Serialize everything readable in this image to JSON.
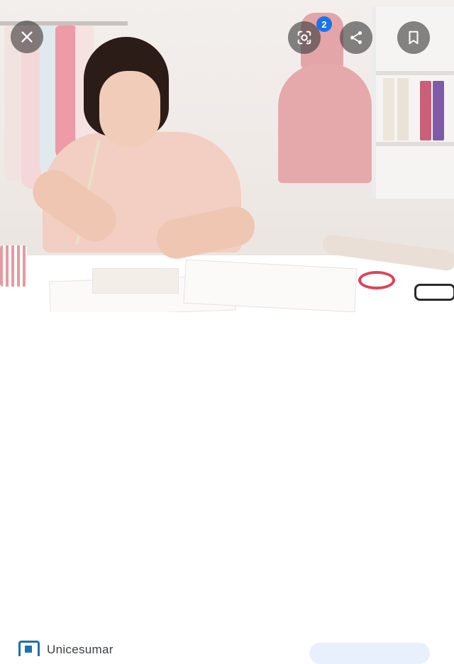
{
  "viewer": {
    "image_subject": "fashion-designer-sketching",
    "lens_badge_count": "2",
    "controls": {
      "close_icon": "close-icon",
      "lens_icon": "google-lens-icon",
      "share_icon": "share-icon",
      "save_icon": "bookmark-icon"
    }
  },
  "source": {
    "name": "Unicesumar",
    "logo_icon": "unicesumar-logo"
  },
  "colors": {
    "control_bg": "#3c3c3c",
    "badge_blue": "#1a73e8",
    "logo_blue": "#1f6fb5",
    "visit_button_bg": "#e8f0fe"
  }
}
